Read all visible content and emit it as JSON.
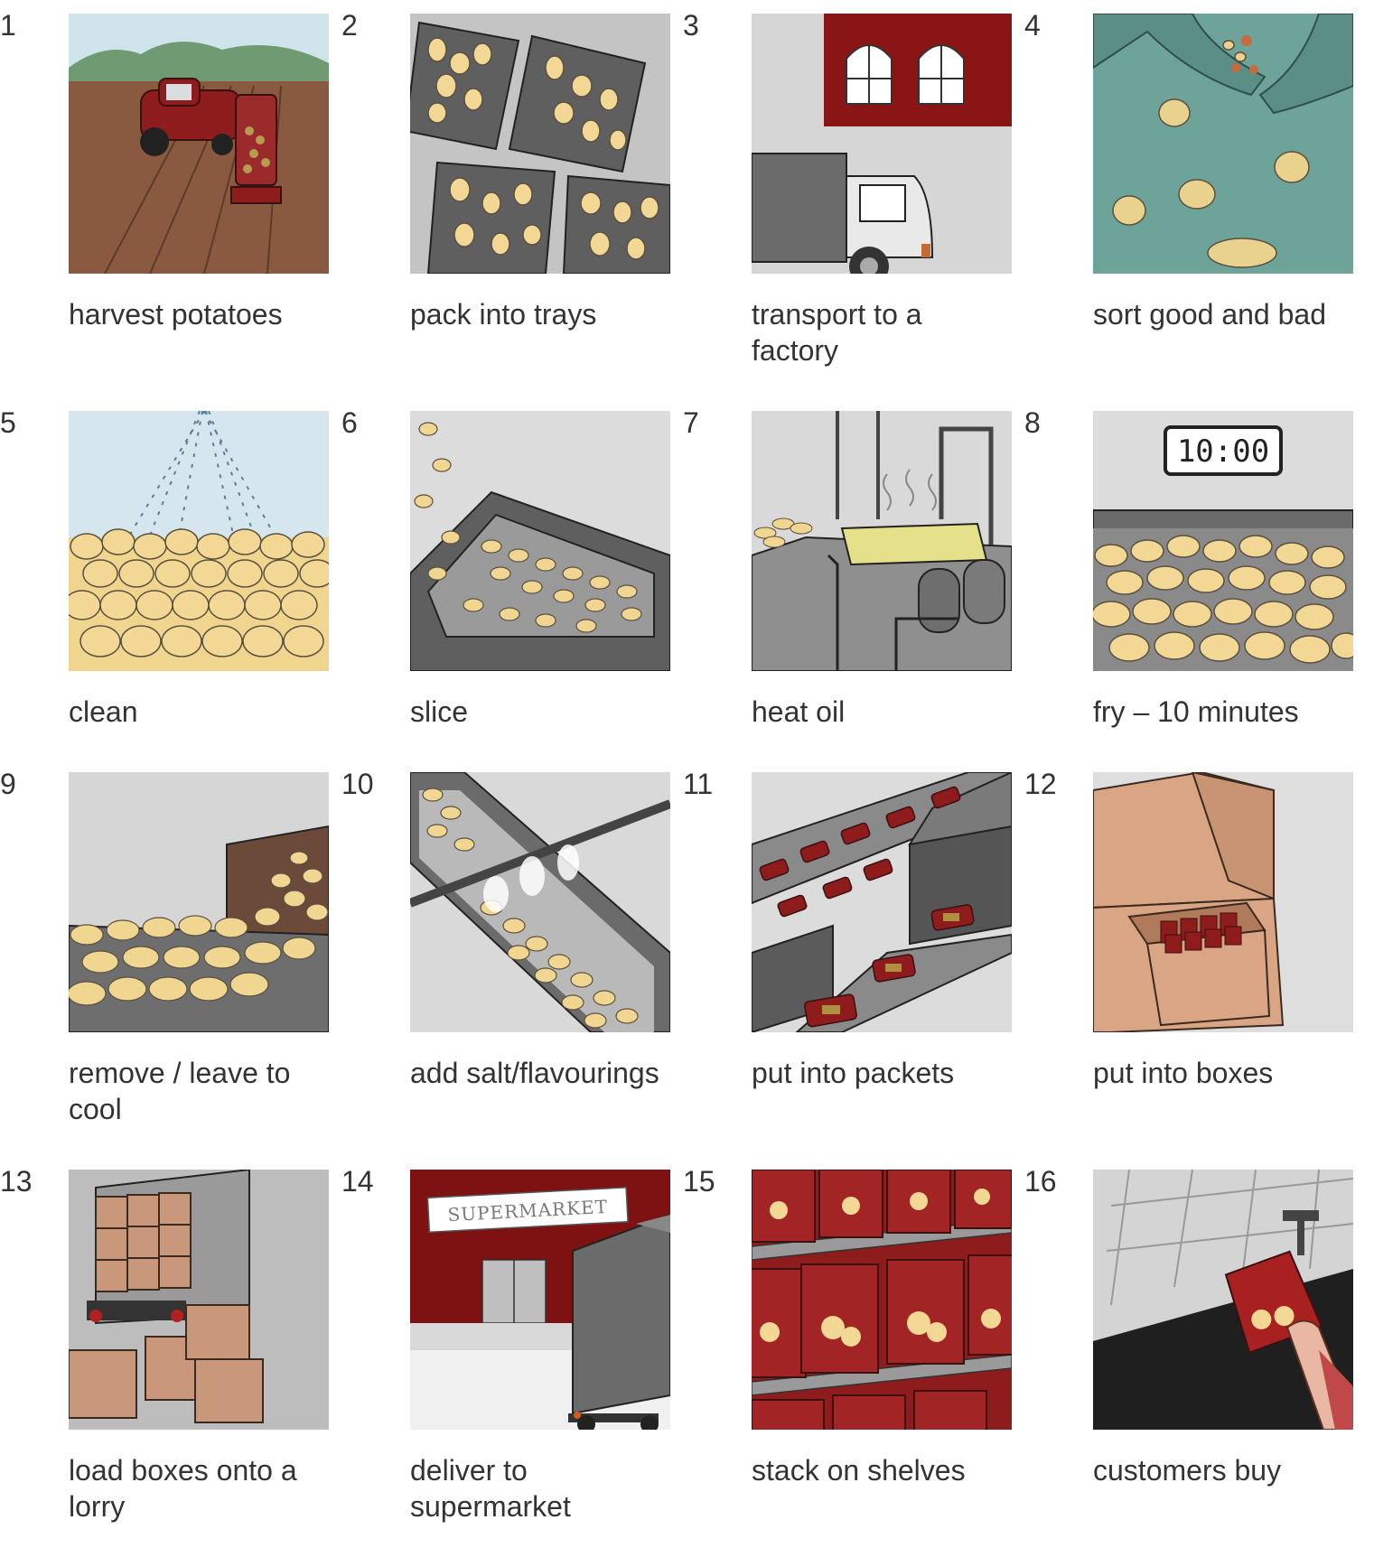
{
  "steps": [
    {
      "number": "1",
      "caption": "harvest potatoes",
      "illustration": "tractor-harvest"
    },
    {
      "number": "2",
      "caption": "pack into trays",
      "illustration": "trays"
    },
    {
      "number": "3",
      "caption": "transport to a factory",
      "illustration": "truck-factory"
    },
    {
      "number": "4",
      "caption": "sort good and bad",
      "illustration": "sorting"
    },
    {
      "number": "5",
      "caption": "clean",
      "illustration": "washing"
    },
    {
      "number": "6",
      "caption": "slice",
      "illustration": "slicer"
    },
    {
      "number": "7",
      "caption": "heat oil",
      "illustration": "fryer"
    },
    {
      "number": "8",
      "caption": "fry – 10 minutes",
      "illustration": "frying-timer",
      "timer": "10:00"
    },
    {
      "number": "9",
      "caption": "remove / leave to cool",
      "illustration": "cooling"
    },
    {
      "number": "10",
      "caption": "add salt/flavourings",
      "illustration": "salting"
    },
    {
      "number": "11",
      "caption": "put into packets",
      "illustration": "packing"
    },
    {
      "number": "12",
      "caption": "put into boxes",
      "illustration": "boxes"
    },
    {
      "number": "13",
      "caption": "load boxes onto a lorry",
      "illustration": "loading"
    },
    {
      "number": "14",
      "caption": "deliver to supermarket",
      "illustration": "delivery",
      "sign": "SUPERMARKET"
    },
    {
      "number": "15",
      "caption": "stack on shelves",
      "illustration": "shelves"
    },
    {
      "number": "16",
      "caption": "customers buy",
      "illustration": "checkout"
    }
  ],
  "colors": {
    "potato": "#f2d894",
    "potato_outline": "#5a5040",
    "brand_red": "#8e1c1c",
    "metal_grey": "#6e6e6e",
    "background_grey": "#d8d8d8"
  }
}
